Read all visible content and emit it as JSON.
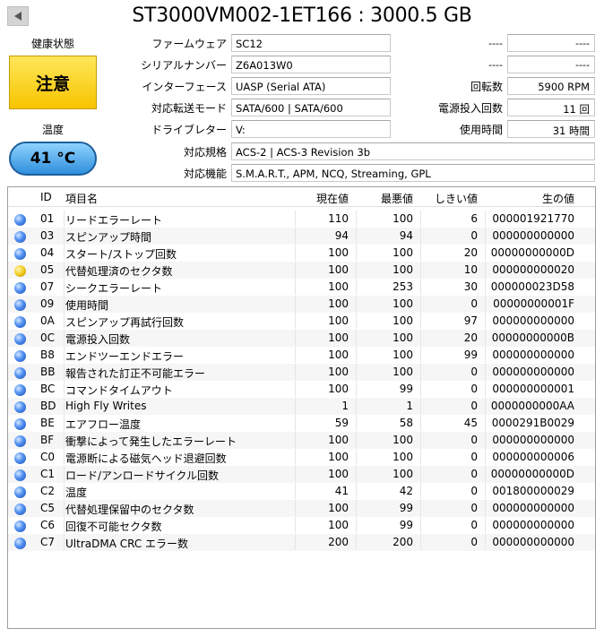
{
  "title": "ST3000VM002-1ET166 : 3000.5 GB",
  "health": {
    "label": "健康状態",
    "status": "注意"
  },
  "temperature": {
    "label": "温度",
    "value": "41 °C"
  },
  "info": {
    "firmware": {
      "label": "ファームウェア",
      "value": "SC12"
    },
    "serial": {
      "label": "シリアルナンバー",
      "value": "Z6A013W0"
    },
    "interface": {
      "label": "インターフェース",
      "value": "UASP (Serial ATA)"
    },
    "transfer": {
      "label": "対応転送モード",
      "value": "SATA/600 | SATA/600"
    },
    "drive_letter": {
      "label": "ドライブレター",
      "value": "V:"
    },
    "standard": {
      "label": "対応規格",
      "value": "ACS-2 | ACS-3 Revision 3b"
    },
    "features": {
      "label": "対応機能",
      "value": "S.M.A.R.T., APM, NCQ, Streaming, GPL"
    }
  },
  "right_info": {
    "row1": {
      "label": "----",
      "value": "----"
    },
    "row2": {
      "label": "----",
      "value": "----"
    },
    "rotation": {
      "label": "回転数",
      "value": "5900 RPM"
    },
    "power_count": {
      "label": "電源投入回数",
      "value": "11 回"
    },
    "power_hours": {
      "label": "使用時間",
      "value": "31 時間"
    }
  },
  "table": {
    "headers": {
      "id": "ID",
      "name": "項目名",
      "current": "現在値",
      "worst": "最悪値",
      "threshold": "しきい値",
      "raw": "生の値"
    },
    "rows": [
      {
        "status": "blue",
        "id": "01",
        "name": "リードエラーレート",
        "current": "110",
        "worst": "100",
        "threshold": "6",
        "raw": "000001921770"
      },
      {
        "status": "blue",
        "id": "03",
        "name": "スピンアップ時間",
        "current": "94",
        "worst": "94",
        "threshold": "0",
        "raw": "000000000000"
      },
      {
        "status": "blue",
        "id": "04",
        "name": "スタート/ストップ回数",
        "current": "100",
        "worst": "100",
        "threshold": "20",
        "raw": "00000000000D"
      },
      {
        "status": "yellow",
        "id": "05",
        "name": "代替処理済のセクタ数",
        "current": "100",
        "worst": "100",
        "threshold": "10",
        "raw": "000000000020"
      },
      {
        "status": "blue",
        "id": "07",
        "name": "シークエラーレート",
        "current": "100",
        "worst": "253",
        "threshold": "30",
        "raw": "000000023D58"
      },
      {
        "status": "blue",
        "id": "09",
        "name": "使用時間",
        "current": "100",
        "worst": "100",
        "threshold": "0",
        "raw": "00000000001F"
      },
      {
        "status": "blue",
        "id": "0A",
        "name": "スピンアップ再試行回数",
        "current": "100",
        "worst": "100",
        "threshold": "97",
        "raw": "000000000000"
      },
      {
        "status": "blue",
        "id": "0C",
        "name": "電源投入回数",
        "current": "100",
        "worst": "100",
        "threshold": "20",
        "raw": "00000000000B"
      },
      {
        "status": "blue",
        "id": "B8",
        "name": "エンドツーエンドエラー",
        "current": "100",
        "worst": "100",
        "threshold": "99",
        "raw": "000000000000"
      },
      {
        "status": "blue",
        "id": "BB",
        "name": "報告された訂正不可能エラー",
        "current": "100",
        "worst": "100",
        "threshold": "0",
        "raw": "000000000000"
      },
      {
        "status": "blue",
        "id": "BC",
        "name": "コマンドタイムアウト",
        "current": "100",
        "worst": "99",
        "threshold": "0",
        "raw": "000000000001"
      },
      {
        "status": "blue",
        "id": "BD",
        "name": "High Fly Writes",
        "current": "1",
        "worst": "1",
        "threshold": "0",
        "raw": "0000000000AA"
      },
      {
        "status": "blue",
        "id": "BE",
        "name": "エアフロー温度",
        "current": "59",
        "worst": "58",
        "threshold": "45",
        "raw": "0000291B0029"
      },
      {
        "status": "blue",
        "id": "BF",
        "name": "衝撃によって発生したエラーレート",
        "current": "100",
        "worst": "100",
        "threshold": "0",
        "raw": "000000000000"
      },
      {
        "status": "blue",
        "id": "C0",
        "name": "電源断による磁気ヘッド退避回数",
        "current": "100",
        "worst": "100",
        "threshold": "0",
        "raw": "000000000006"
      },
      {
        "status": "blue",
        "id": "C1",
        "name": "ロード/アンロードサイクル回数",
        "current": "100",
        "worst": "100",
        "threshold": "0",
        "raw": "00000000000D"
      },
      {
        "status": "blue",
        "id": "C2",
        "name": "温度",
        "current": "41",
        "worst": "42",
        "threshold": "0",
        "raw": "001800000029"
      },
      {
        "status": "blue",
        "id": "C5",
        "name": "代替処理保留中のセクタ数",
        "current": "100",
        "worst": "99",
        "threshold": "0",
        "raw": "000000000000"
      },
      {
        "status": "blue",
        "id": "C6",
        "name": "回復不可能セクタ数",
        "current": "100",
        "worst": "99",
        "threshold": "0",
        "raw": "000000000000"
      },
      {
        "status": "blue",
        "id": "C7",
        "name": "UltraDMA CRC エラー数",
        "current": "200",
        "worst": "200",
        "threshold": "0",
        "raw": "000000000000"
      }
    ]
  }
}
